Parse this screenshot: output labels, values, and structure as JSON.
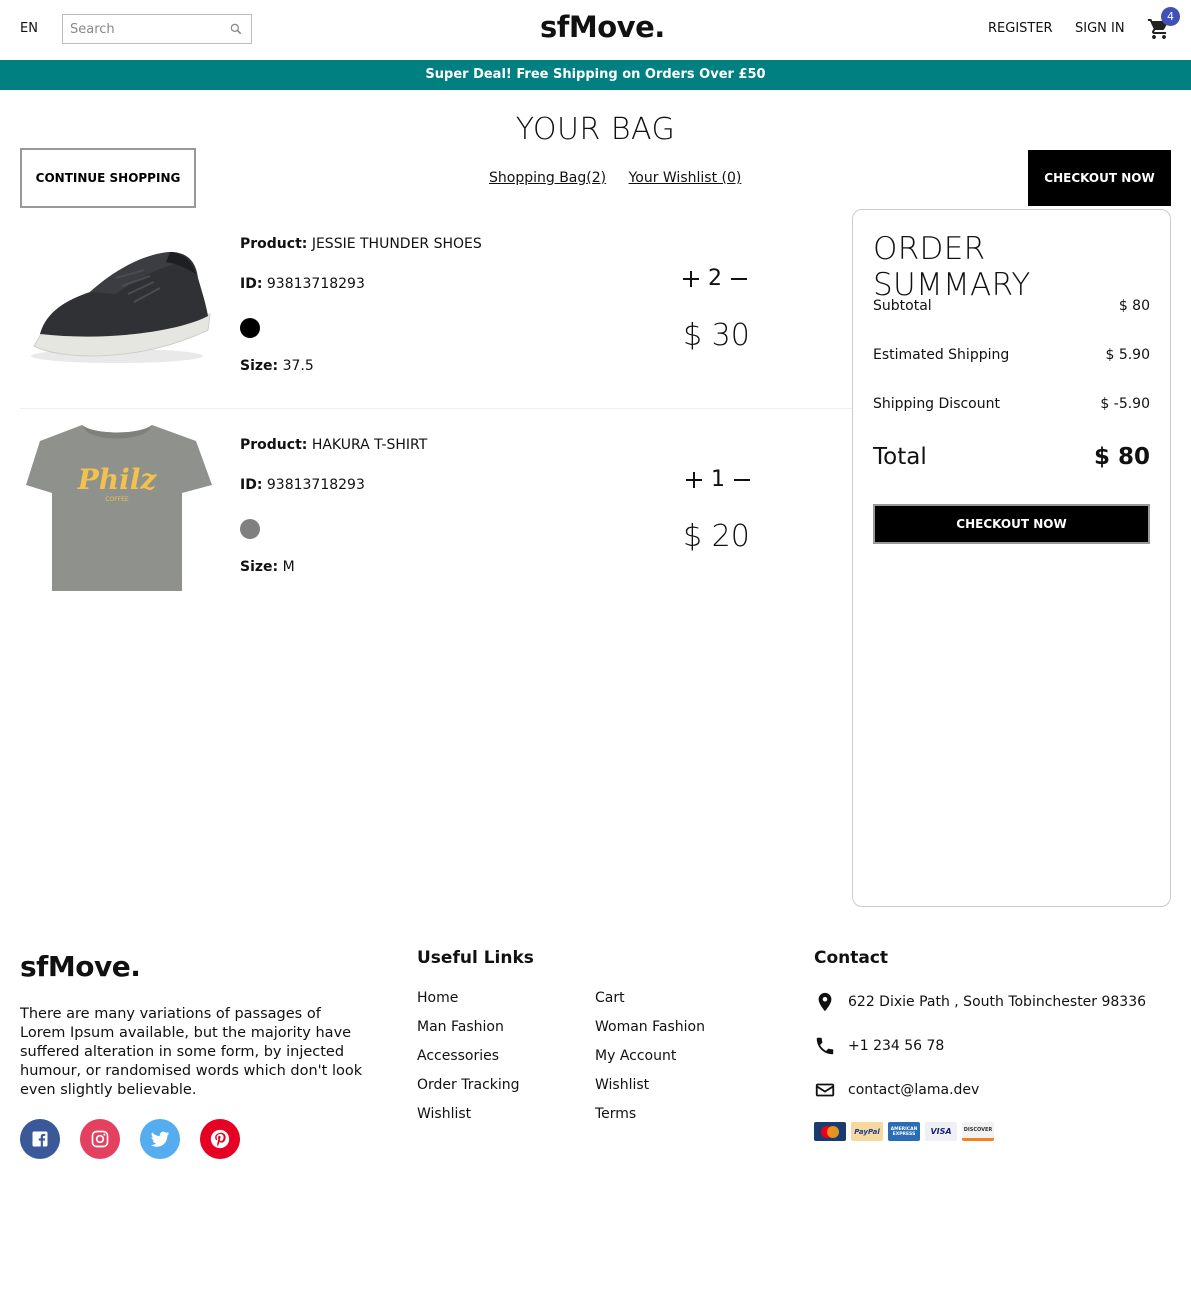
{
  "navbar": {
    "language": "EN",
    "search_placeholder": "Search",
    "logo": "sfMove.",
    "register": "REGISTER",
    "sign_in": "SIGN IN",
    "cart_count": "4"
  },
  "announcement": "Super Deal! Free Shipping on Orders Over £50",
  "page_title": "YOUR BAG",
  "top": {
    "continue_label": "CONTINUE SHOPPING",
    "bag_link": "Shopping Bag(2)",
    "wishlist_link": "Your Wishlist (0)",
    "checkout_label": "CHECKOUT NOW"
  },
  "products": [
    {
      "product_label": "Product:",
      "product_name": "JESSIE THUNDER SHOES",
      "id_label": "ID:",
      "id_value": "93813718293",
      "color": "#000000",
      "size_label": "Size:",
      "size_value": "37.5",
      "quantity": "2",
      "price": "$ 30"
    },
    {
      "product_label": "Product:",
      "product_name": "HAKURA T-SHIRT",
      "id_label": "ID:",
      "id_value": "93813718293",
      "color": "#808080",
      "size_label": "Size:",
      "size_value": "M",
      "quantity": "1",
      "price": "$ 20"
    }
  ],
  "summary": {
    "title": "ORDER SUMMARY",
    "subtotal_label": "Subtotal",
    "subtotal_value": "$ 80",
    "shipping_label": "Estimated Shipping",
    "shipping_value": "$ 5.90",
    "discount_label": "Shipping Discount",
    "discount_value": "$ -5.90",
    "total_label": "Total",
    "total_value": "$ 80",
    "checkout_label": "CHECKOUT NOW"
  },
  "footer": {
    "logo": "sfMove.",
    "description": "There are many variations of passages of Lorem Ipsum available, but the majority have suffered alteration in some form, by injected humour, or randomised words which don't look even slightly believable.",
    "socials": [
      {
        "name": "facebook",
        "color": "#3B5999"
      },
      {
        "name": "instagram",
        "color": "#E4405F"
      },
      {
        "name": "twitter",
        "color": "#55ACEE"
      },
      {
        "name": "pinterest",
        "color": "#E60023"
      }
    ],
    "useful_links_title": "Useful Links",
    "links_left": [
      "Home",
      "Man Fashion",
      "Accessories",
      "Order Tracking",
      "Wishlist"
    ],
    "links_right": [
      "Cart",
      "Woman Fashion",
      "My Account",
      "Wishlist",
      "Terms"
    ],
    "contact_title": "Contact",
    "address": "622 Dixie Path , South Tobinchester 98336",
    "phone": "+1 234 56 78",
    "email": "contact@lama.dev",
    "payments": [
      "MasterCard",
      "PayPal",
      "AMERICAN EXPRESS",
      "VISA",
      "DISCOVER"
    ]
  },
  "colors": {
    "announcement_bg": "#008080",
    "badge": "#3f51b5"
  }
}
